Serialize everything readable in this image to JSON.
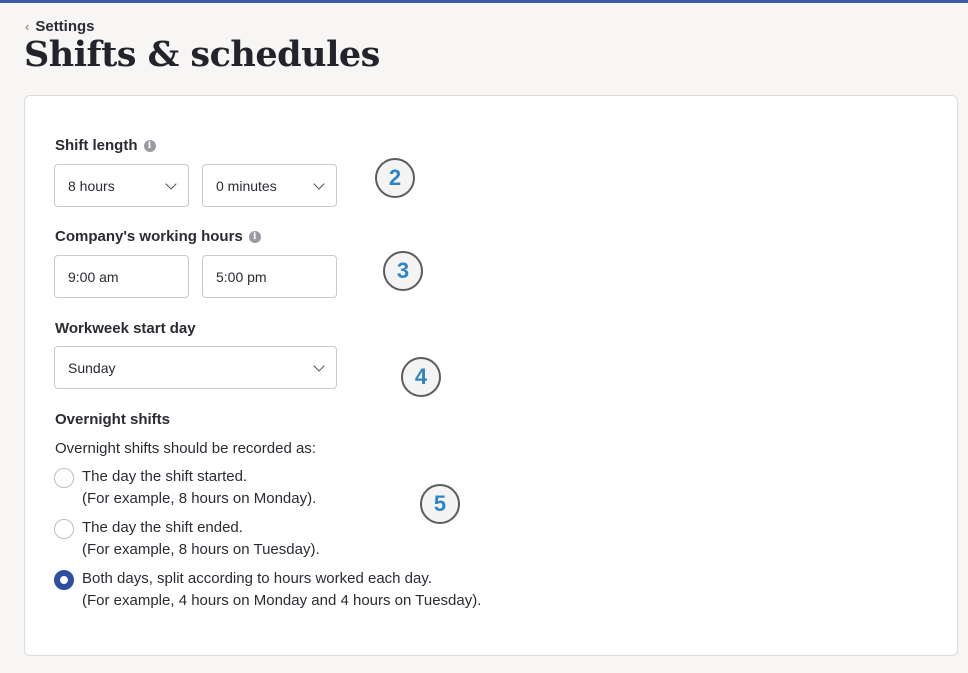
{
  "breadcrumb": {
    "label": "Settings"
  },
  "page": {
    "title": "Shifts & schedules"
  },
  "shift_length": {
    "label": "Shift length",
    "hours_value": "8 hours",
    "minutes_value": "0 minutes"
  },
  "working_hours": {
    "label": "Company's working hours",
    "start_value": "9:00 am",
    "end_value": "5:00 pm"
  },
  "workweek": {
    "label": "Workweek start day",
    "value": "Sunday"
  },
  "overnight": {
    "label": "Overnight shifts",
    "description": "Overnight shifts should be recorded as:",
    "options": [
      {
        "line1": "The day the shift started.",
        "line2": "(For example, 8 hours on Monday).",
        "selected": false
      },
      {
        "line1": "The day the shift ended.",
        "line2": "(For example, 8 hours on Tuesday).",
        "selected": false
      },
      {
        "line1": "Both days, split according to hours worked each day.",
        "line2": "(For example, 4 hours on Monday and 4 hours on Tuesday).",
        "selected": true
      }
    ]
  },
  "annotations": [
    "2",
    "3",
    "4",
    "5"
  ],
  "icons": {
    "back": "chevron-left-icon",
    "info": "info-icon",
    "dropdown": "chevron-down-icon"
  },
  "colors": {
    "top_bar": "#3d5aa8",
    "radio_selected": "#2f4ea0",
    "badge_number": "#2d85c8"
  }
}
